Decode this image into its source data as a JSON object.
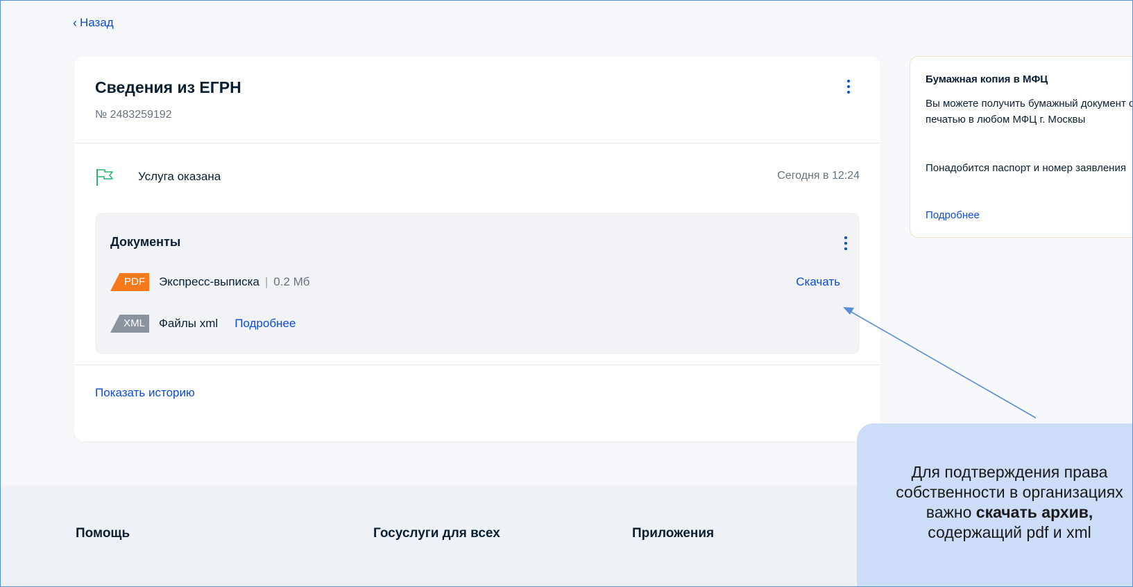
{
  "back": {
    "label": "Назад"
  },
  "order": {
    "title": "Сведения из ЕГРН",
    "number": "№ 2483259192",
    "status": {
      "label": "Услуга оказана",
      "time": "Сегодня в 12:24",
      "icon": "flag-icon",
      "icon_color": "#2db36f"
    }
  },
  "documents": {
    "title": "Документы",
    "items": [
      {
        "badge": "PDF",
        "name": "Экспресс-выписка",
        "separator": "|",
        "size": "0.2 Мб",
        "action": "Скачать",
        "badge_color": "#f6791b"
      },
      {
        "badge": "XML",
        "name": "Файлы xml",
        "action": "Подробнее",
        "badge_color": "#8a939e"
      }
    ]
  },
  "history_link": "Показать историю",
  "aside": {
    "title": "Бумажная копия в МФЦ",
    "text1": "Вы можете получить бумажный документ с печатью в любом МФЦ г. Москвы",
    "text2": "Понадобится паспорт и номер заявления",
    "more": "Подробнее"
  },
  "callout": {
    "line1": "Для подтверждения права",
    "line2": "собственности в организациях",
    "line3_prefix": "важно ",
    "line3_bold": "скачать архив,",
    "line4": "содержащий pdf и xml"
  },
  "footer": {
    "columns": [
      "Помощь",
      "Госуслуги для всех",
      "Приложения"
    ]
  },
  "colors": {
    "accent": "#0d4cd3",
    "page_bg": "#f6f8fb",
    "callout_bg": "#cddcf7",
    "arrow": "#5a8fd1"
  }
}
